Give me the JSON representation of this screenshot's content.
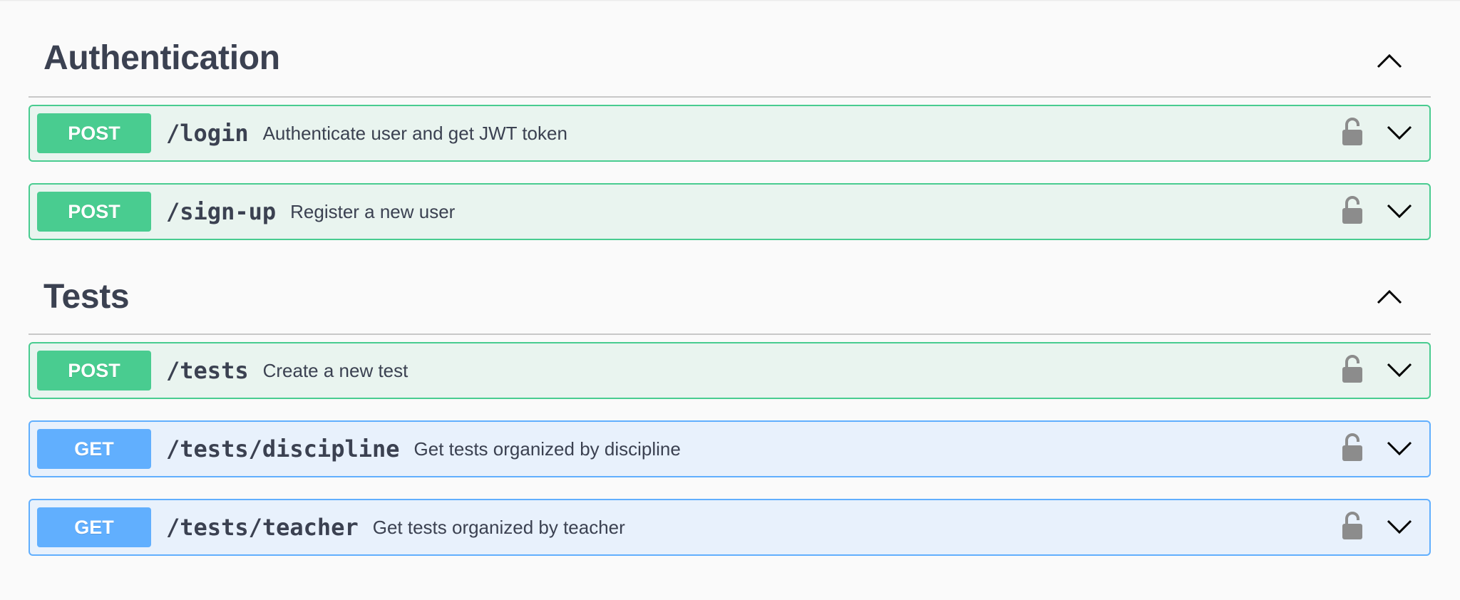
{
  "sections": [
    {
      "title": "Authentication",
      "operations": [
        {
          "method": "POST",
          "path": "/login",
          "description": "Authenticate user and get JWT token"
        },
        {
          "method": "POST",
          "path": "/sign-up",
          "description": "Register a new user"
        }
      ]
    },
    {
      "title": "Tests",
      "operations": [
        {
          "method": "POST",
          "path": "/tests",
          "description": "Create a new test"
        },
        {
          "method": "GET",
          "path": "/tests/discipline",
          "description": "Get tests organized by discipline"
        },
        {
          "method": "GET",
          "path": "/tests/teacher",
          "description": "Get tests organized by teacher"
        }
      ]
    }
  ],
  "icons": {
    "lock": "lock-icon",
    "expand": "chevron-down-icon",
    "collapse": "chevron-up-icon"
  },
  "colors": {
    "post": "#49cc90",
    "post_bg": "#e9f4ef",
    "get": "#61affe",
    "get_bg": "#e8f1fc"
  }
}
